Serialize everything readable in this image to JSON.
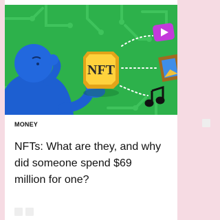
{
  "card": {
    "category": "MONEY",
    "headline": "NFTs: What are they, and why did someone spend $69 million for one?",
    "image": {
      "badge_text": "NFT",
      "background_color": "#2db14b",
      "icons": [
        "person-thinking-icon",
        "nft-coin-icon",
        "play-button-icon",
        "picture-frame-icon",
        "music-note-icon"
      ]
    },
    "actions": {
      "bookmark_icon": "bookmark-icon",
      "share_icons": [
        "share-icon",
        "share-icon"
      ]
    }
  }
}
